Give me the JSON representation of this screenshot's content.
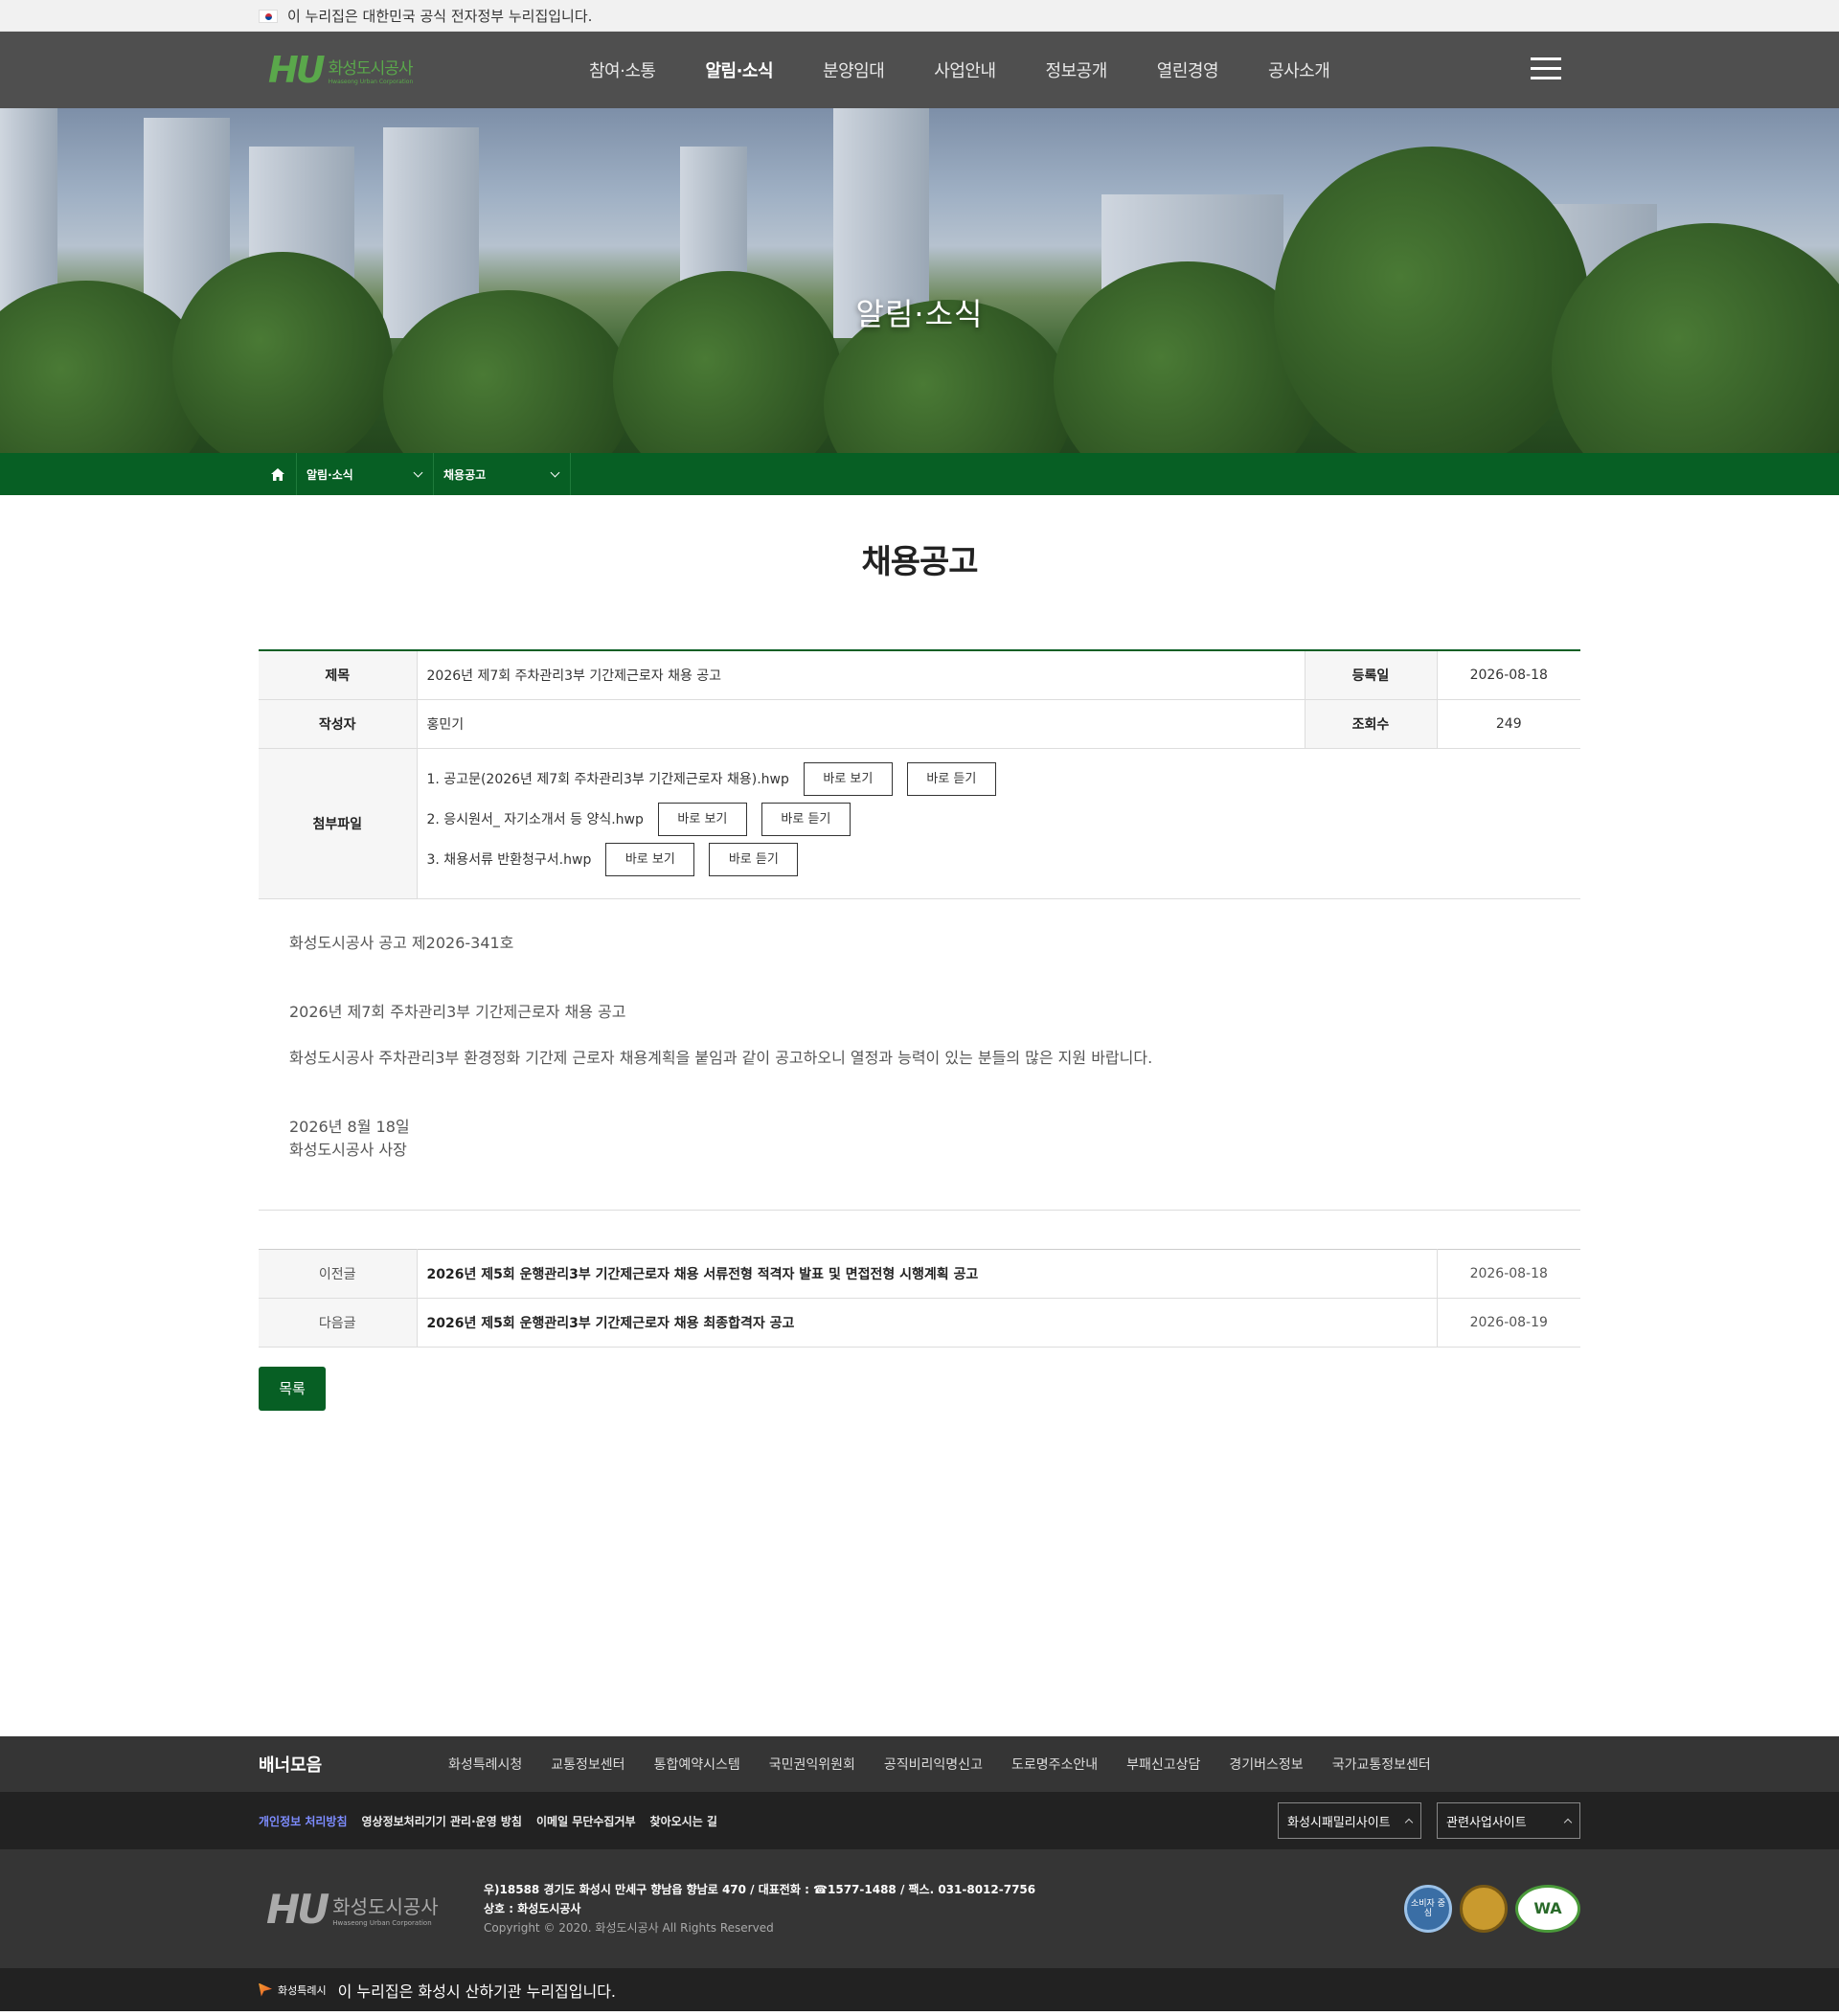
{
  "gov_notice": "이 누리집은 대한민국 공식 전자정부 누리집입니다.",
  "header": {
    "logo_ko": "화성도시공사",
    "logo_en": "Hwaseong Urban Corporation",
    "menu": [
      "참여·소통",
      "알림·소식",
      "분양임대",
      "사업안내",
      "정보공개",
      "열린경영",
      "공사소개"
    ],
    "active_menu": "알림·소식"
  },
  "hero": {
    "title": "알림·소식"
  },
  "breadcrumb": {
    "depth1": "알림·소식",
    "depth2": "채용공고"
  },
  "page_title": "채용공고",
  "post": {
    "labels": {
      "title": "제목",
      "date": "등록일",
      "author": "작성자",
      "views": "조회수",
      "files": "첨부파일"
    },
    "title": "2026년 제7회 주차관리3부 기간제근로자 채용 공고",
    "date": "2026-08-18",
    "author": "홍민기",
    "views": "249",
    "view_label": "바로 보기",
    "listen_label": "바로 듣기",
    "files": [
      "1. 공고문(2026년 제7회 주차관리3부 기간제근로자 채용).hwp",
      "2. 응시원서_ 자기소개서 등 양식.hwp",
      "3. 채용서류 반환청구서.hwp"
    ],
    "body": {
      "notice_no": "화성도시공사 공고 제2026-341호",
      "headline": "2026년 제7회 주차관리3부 기간제근로자 채용 공고",
      "text": "화성도시공사 주차관리3부 환경정화 기간제 근로자 채용계획을 붙임과 같이 공고하오니 열정과 능력이 있는 분들의 많은 지원 바랍니다.",
      "sign_date": "2026년 8월 18일",
      "signer": "화성도시공사 사장"
    }
  },
  "navigation": {
    "prev_label": "이전글",
    "prev_title": "2026년 제5회 운행관리3부 기간제근로자 채용 서류전형 적격자 발표 및 면접전형 시행계획 공고",
    "prev_date": "2026-08-18",
    "next_label": "다음글",
    "next_title": "2026년 제5회 운행관리3부 기간제근로자 채용 최종합격자 공고",
    "next_date": "2026-08-19"
  },
  "list_button": "목록",
  "footer": {
    "banner_title": "배너모음",
    "banners": [
      "화성특례시청",
      "교통정보센터",
      "통합예약시스템",
      "국민권익위원회",
      "공직비리익명신고",
      "도로명주소안내",
      "부패신고상담",
      "경기버스정보",
      "국가교통정보센터"
    ],
    "links": [
      "개인정보 처리방침",
      "영상정보처리기기 관리·운영 방침",
      "이메일 무단수집거부",
      "찾아오시는 길"
    ],
    "family_site": "화성시패밀리사이트",
    "related_site": "관련사업사이트",
    "logo_ko": "화성도시공사",
    "logo_en": "Hwaseong Urban Corporation",
    "address": "우)18588 경기도 화성시 만세구 향남읍 향남로 470 / 대표전화 : ☎1577-1488 / 팩스. 031-8012-7756",
    "company": "상호 : 화성도시공사",
    "copyright": "Copyright © 2020. 화성도시공사 All Rights Reserved",
    "cert1": "소비자 중심",
    "cert3": "WA",
    "city_small": "화성특례시",
    "city_notice": "이 누리집은 화성시 산하기관 누리집입니다."
  }
}
